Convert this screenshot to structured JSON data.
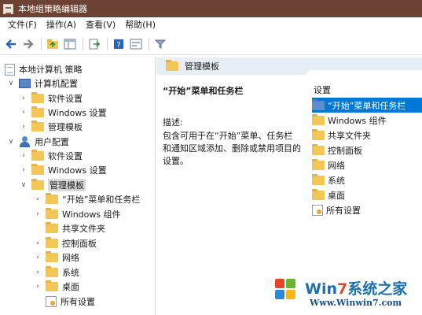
{
  "window": {
    "title": "本地组策略编辑器"
  },
  "menu": [
    "文件(F)",
    "操作(A)",
    "查看(V)",
    "帮助(H)"
  ],
  "toolbar": [
    "back-icon",
    "forward-icon",
    "folder-up-icon",
    "show-hide-tree-icon",
    "export-list-icon",
    "help-icon",
    "properties-icon",
    "filter-icon"
  ],
  "tree": {
    "root": "本地计算机 策略",
    "computer_config": "计算机配置",
    "computer_children": [
      "软件设置",
      "Windows 设置",
      "管理模板"
    ],
    "user_config": "用户配置",
    "user_children": [
      "软件设置",
      "Windows 设置",
      "管理模板"
    ],
    "admin_templates_children": [
      "“开始”菜单和任务栏",
      "Windows 组件",
      "共享文件夹",
      "控制面板",
      "网络",
      "系统",
      "桌面",
      "所有设置"
    ]
  },
  "right": {
    "header": "管理模板",
    "desc_title": "“开始”菜单和任务栏",
    "desc_label": "描述:",
    "desc_text": "包含可用于在“开始”菜单、任务栏和通知区域添加、删除或禁用项目的设置。",
    "settings_header": "设置",
    "settings": [
      "“开始”菜单和任务栏",
      "Windows 组件",
      "共享文件夹",
      "控制面板",
      "网络",
      "系统",
      "桌面",
      "所有设置"
    ]
  },
  "watermark": {
    "title_a": "Win",
    "title_b": "7",
    "title_c": "系统之家",
    "url": "Www.Winwin7.com"
  },
  "colors": {
    "titlebar": "#6b4234",
    "selection": "#0078d7",
    "folder": "#f2c758"
  }
}
